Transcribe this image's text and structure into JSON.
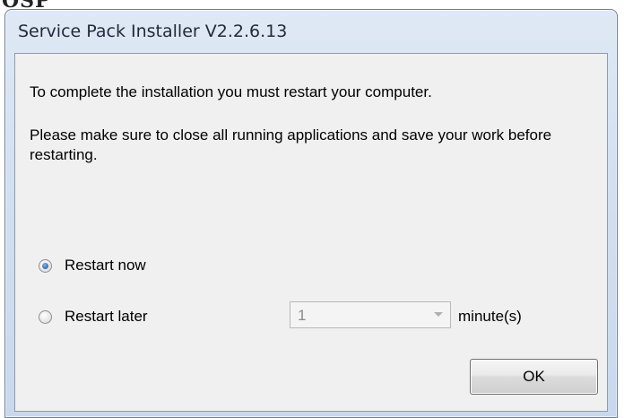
{
  "background_fragment": "OSP",
  "window": {
    "title": "Service Pack Installer V2.2.6.13"
  },
  "message": {
    "line1": "To complete the installation you must restart your computer.",
    "line2": "Please make sure to close all running applications and save your work before restarting."
  },
  "options": {
    "restart_now": {
      "label": "Restart now",
      "checked": true
    },
    "restart_later": {
      "label": "Restart later",
      "checked": false
    }
  },
  "delay": {
    "value": "1",
    "unit": "minute(s)",
    "enabled": false
  },
  "buttons": {
    "ok": "OK"
  },
  "colors": {
    "title_bar": "#d3e0f0",
    "client_bg": "#f0f0f0",
    "radio_accent": "#2a6fb8"
  }
}
